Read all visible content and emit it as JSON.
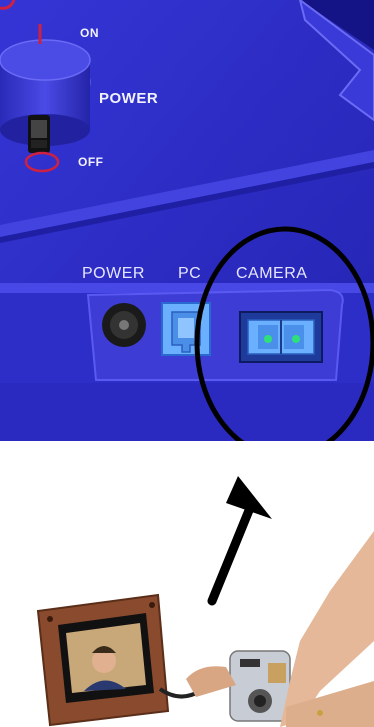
{
  "device_panel": {
    "switch": {
      "on_label": "ON",
      "power_label": "POWER",
      "off_label": "OFF"
    },
    "ports": {
      "power_label": "POWER",
      "pc_label": "PC",
      "camera_label": "CAMERA"
    }
  },
  "callout": {
    "shape": "ellipse",
    "highlights": "camera-port",
    "color": "#000000"
  },
  "colors": {
    "panel_blue": "#2d2ec8",
    "panel_dark": "#1a1a9c",
    "port_light_blue": "#6ab0ff",
    "led_green": "#2ee07a",
    "frame_wood": "#8a4a2e"
  },
  "photo": {
    "subject": "hand connecting a camera to a digital picture frame"
  }
}
